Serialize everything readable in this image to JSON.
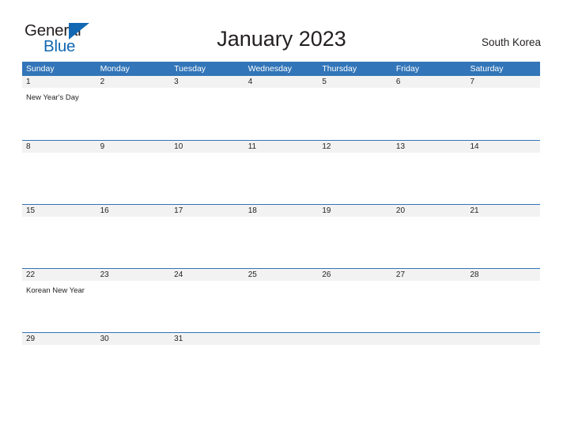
{
  "logo": {
    "word_one": "General",
    "word_two": "Blue",
    "triangle_color": "#1268b3"
  },
  "header": {
    "title": "January 2023",
    "region": "South Korea"
  },
  "theme": {
    "header_blue": "#3275b8",
    "band_gray": "#f2f2f2",
    "text_dark": "#231f20",
    "logo_blue": "#1268b3"
  },
  "calendar": {
    "weekdays": [
      "Sunday",
      "Monday",
      "Tuesday",
      "Wednesday",
      "Thursday",
      "Friday",
      "Saturday"
    ],
    "weeks": [
      {
        "dates": [
          "1",
          "2",
          "3",
          "4",
          "5",
          "6",
          "7"
        ],
        "events": [
          "New Year's Day",
          "",
          "",
          "",
          "",
          "",
          ""
        ]
      },
      {
        "dates": [
          "8",
          "9",
          "10",
          "11",
          "12",
          "13",
          "14"
        ],
        "events": [
          "",
          "",
          "",
          "",
          "",
          "",
          ""
        ]
      },
      {
        "dates": [
          "15",
          "16",
          "17",
          "18",
          "19",
          "20",
          "21"
        ],
        "events": [
          "",
          "",
          "",
          "",
          "",
          "",
          ""
        ]
      },
      {
        "dates": [
          "22",
          "23",
          "24",
          "25",
          "26",
          "27",
          "28"
        ],
        "events": [
          "Korean New Year",
          "",
          "",
          "",
          "",
          "",
          ""
        ]
      },
      {
        "dates": [
          "29",
          "30",
          "31",
          "",
          "",
          "",
          ""
        ],
        "events": [
          "",
          "",
          "",
          "",
          "",
          "",
          ""
        ]
      }
    ]
  }
}
